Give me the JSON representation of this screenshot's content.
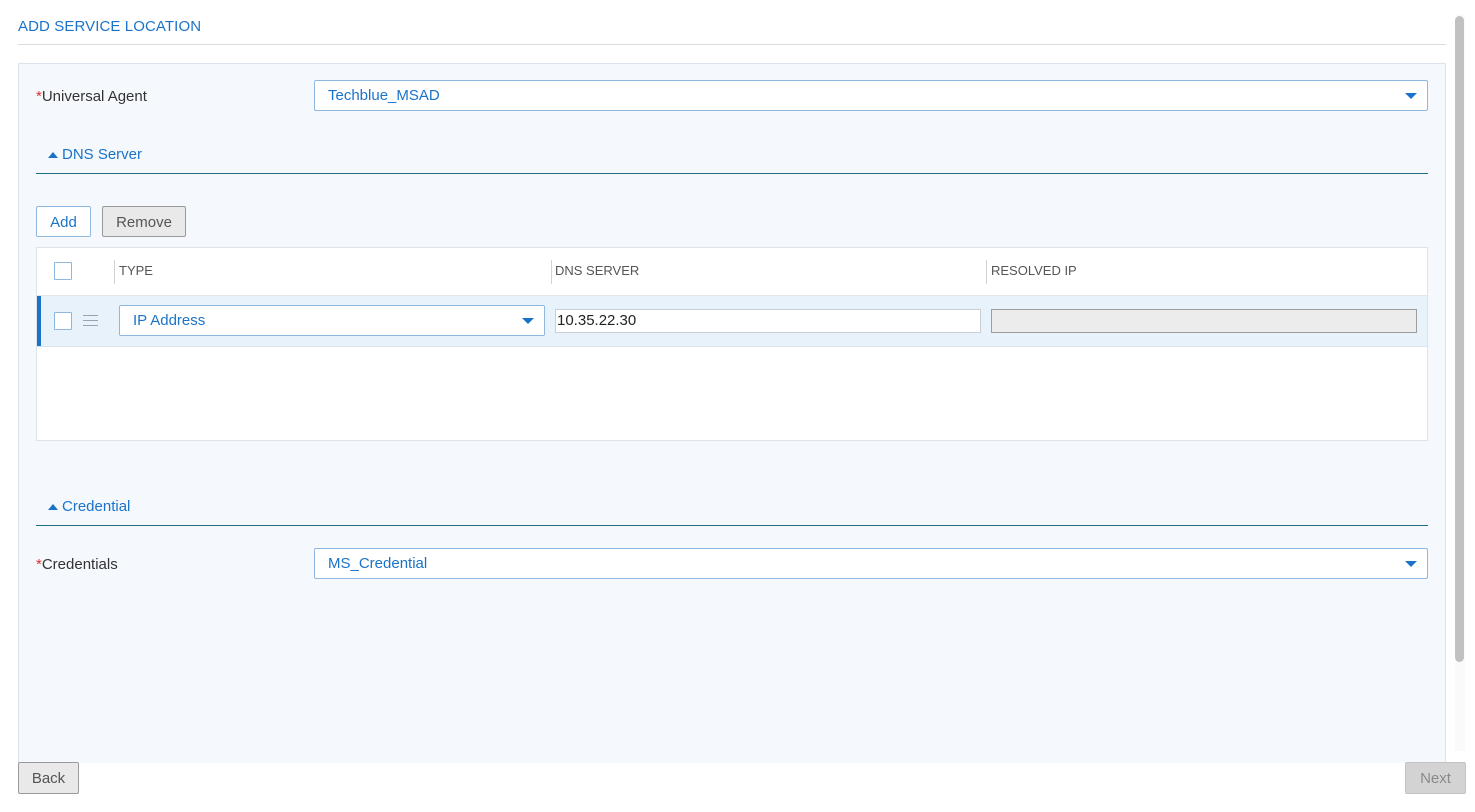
{
  "page": {
    "title": "ADD SERVICE LOCATION"
  },
  "form": {
    "universal_agent": {
      "required_mark": "*",
      "label": "Universal Agent",
      "value": "Techblue_MSAD"
    },
    "dns_section": {
      "title": "DNS Server",
      "add_label": "Add",
      "remove_label": "Remove",
      "columns": [
        "TYPE",
        "DNS SERVER",
        "RESOLVED IP"
      ],
      "rows": [
        {
          "type": "IP Address",
          "dns_server": "10.35.22.30",
          "resolved_ip": ""
        }
      ]
    },
    "credential_section": {
      "title": "Credential",
      "credentials": {
        "required_mark": "*",
        "label": "Credentials",
        "value": "MS_Credential"
      }
    }
  },
  "footer": {
    "back_label": "Back",
    "next_label": "Next"
  },
  "colors": {
    "accent": "#1a73c9",
    "required": "#d9342b",
    "panel_bg": "#f5f9fd"
  }
}
